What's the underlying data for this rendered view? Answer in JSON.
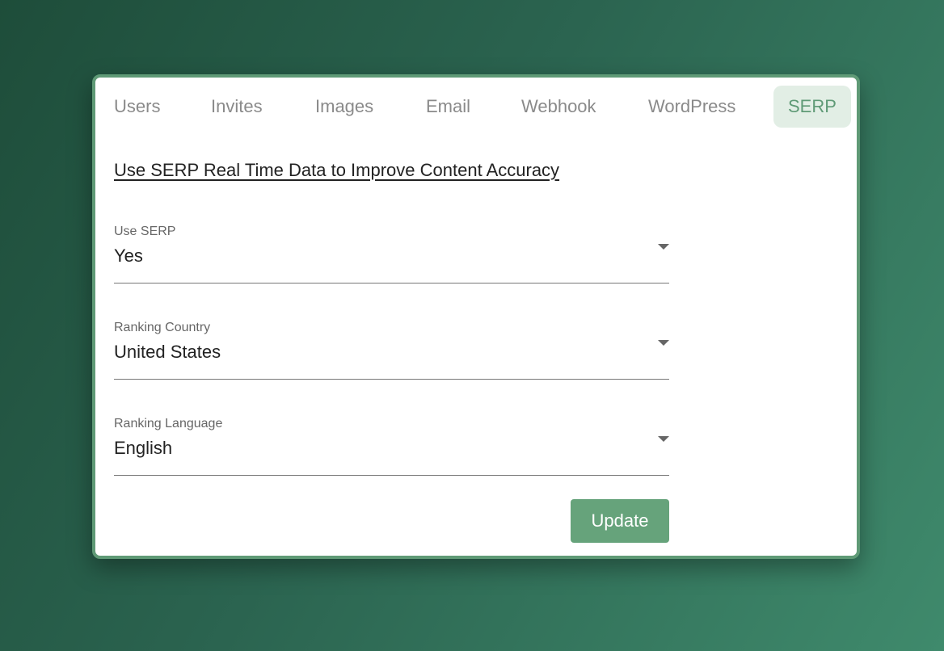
{
  "tabs": [
    {
      "label": "Users"
    },
    {
      "label": "Invites"
    },
    {
      "label": "Images"
    },
    {
      "label": "Email"
    },
    {
      "label": "Webhook"
    },
    {
      "label": "WordPress"
    },
    {
      "label": "SERP"
    }
  ],
  "active_tab": "SERP",
  "heading": "Use SERP Real Time Data to Improve Content Accuracy",
  "fields": [
    {
      "label": "Use SERP",
      "value": "Yes"
    },
    {
      "label": "Ranking Country",
      "value": "United States"
    },
    {
      "label": "Ranking Language",
      "value": "English"
    }
  ],
  "update_button": "Update",
  "colors": {
    "accent": "#66a37b",
    "active_tab_bg": "#e2eee5",
    "active_tab_text": "#5f9a76",
    "card_border": "#5f9a76"
  }
}
